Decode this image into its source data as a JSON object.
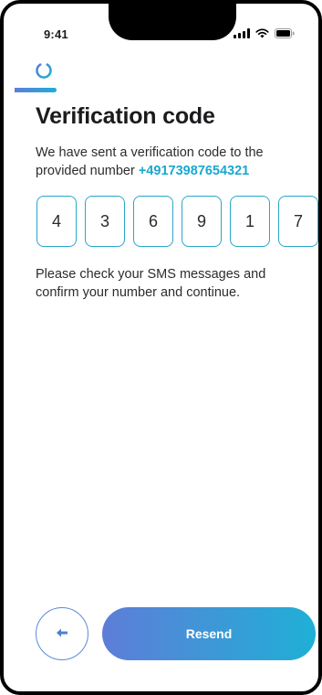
{
  "status_bar": {
    "time": "9:41",
    "icons": [
      "signal-icon",
      "wifi-icon",
      "battery-icon"
    ]
  },
  "header": {
    "logo_icon": "loading-ring-icon",
    "progress": 0.36
  },
  "main": {
    "title": "Verification code",
    "description_prefix": "We have sent a verification code to the provided number ",
    "phone_number": "+49173987654321",
    "code_digits": [
      "4",
      "3",
      "6",
      "9",
      "1",
      "7"
    ],
    "hint": "Please check your SMS messages and confirm your number and continue."
  },
  "footer": {
    "back_icon": "arrow-left-icon",
    "resend_label": "Resend"
  },
  "colors": {
    "accent": "#1aa8cf",
    "gradient_start": "#5e7dd8",
    "gradient_end": "#1fb0d6",
    "text": "#1b1b1d"
  }
}
